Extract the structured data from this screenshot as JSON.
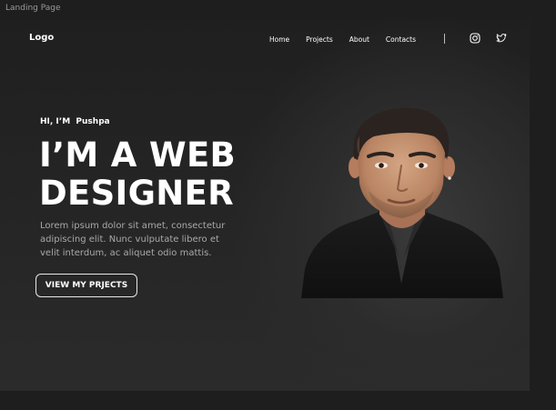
{
  "canvas": {
    "frame_label": "Landing Page"
  },
  "header": {
    "logo": "Logo",
    "nav": [
      "Home",
      "Projects",
      "About",
      "Contacts"
    ],
    "social_icons": [
      "instagram-icon",
      "twitter-icon"
    ]
  },
  "hero": {
    "greeting": "HI, I’M  Pushpa",
    "title_line1": "I’M A WEB",
    "title_line2": "DESIGNER",
    "description": "Lorem ipsum dolor sit amet, consectetur adipiscing elit. Nunc vulputate libero et velit interdum, ac aliquet odio mattis.",
    "cta_label": "VIEW MY PRJECTS"
  },
  "colors": {
    "background": "#1e1e1e",
    "text": "#ffffff",
    "muted_text": "#a9a9a9"
  }
}
